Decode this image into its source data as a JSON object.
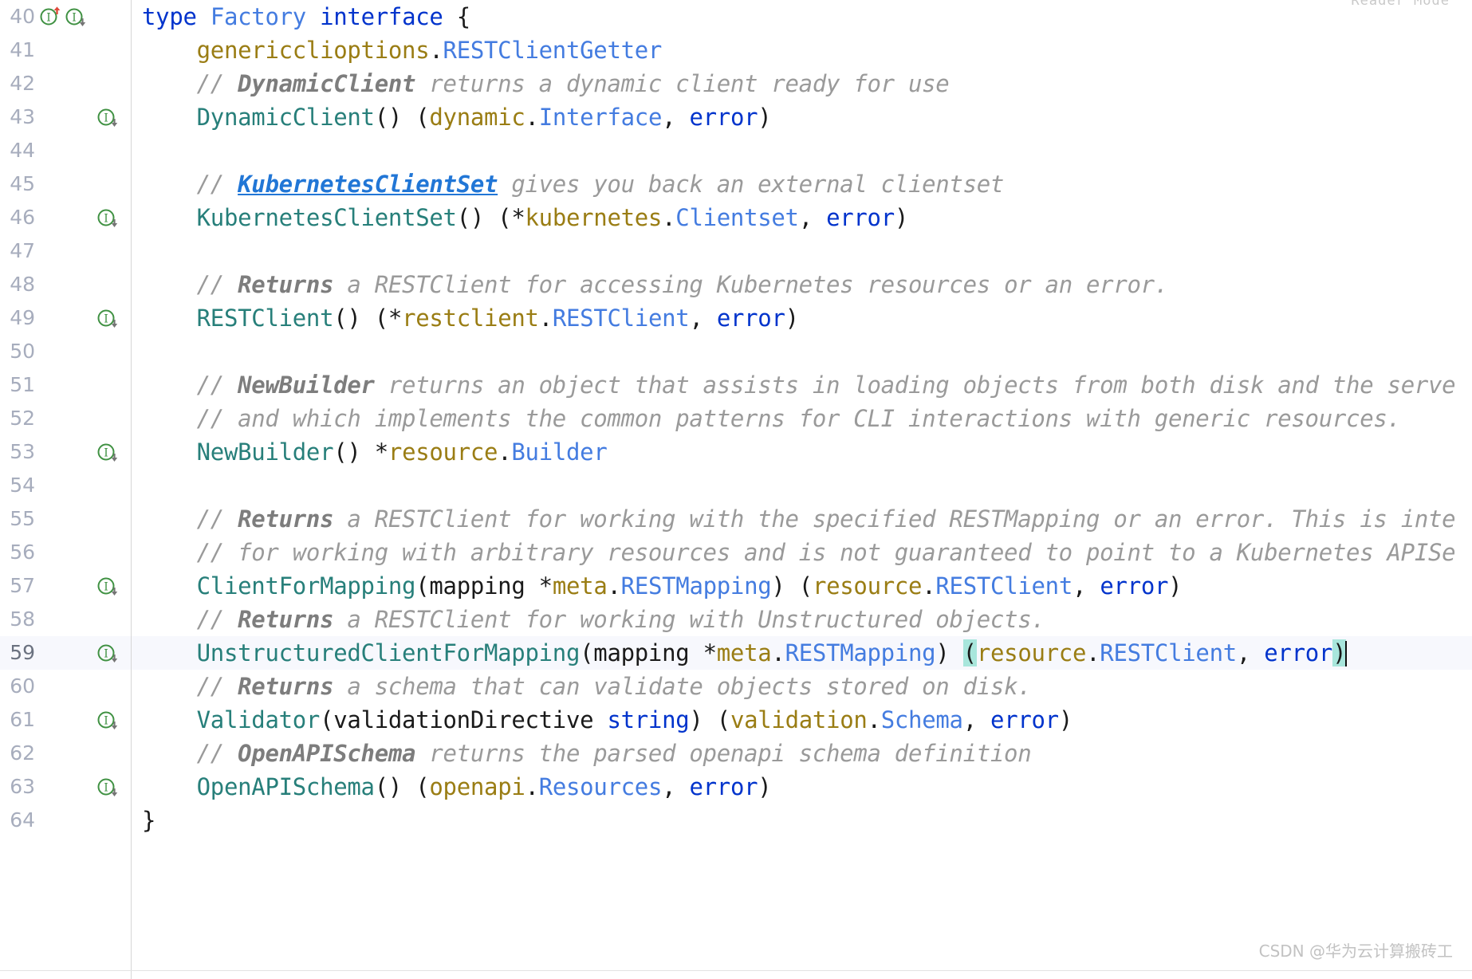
{
  "editor": {
    "reader_mode_label": "Reader Mode",
    "watermark": "CSDN @华为云计算搬砖工",
    "colors": {
      "background": "#ffffff",
      "current_line": "#f7f8fd",
      "keyword": "#0033cc",
      "package": "#9a7d14",
      "type": "#447ce0",
      "function": "#277f7a",
      "comment": "#9a9a9a",
      "comment_link": "#2176d6",
      "brace_match_highlight": "#a8e6dc",
      "gutter_line_number": "#a7adbd",
      "gutter_icon_green": "#3f9142",
      "gutter_arrow_red": "#e04a3c",
      "gutter_arrow_gray": "#757575"
    },
    "gutter_icons": {
      "implementing": "implementing-method-icon",
      "implemented": "implemented-method-icon"
    },
    "lines": [
      {
        "n": "40",
        "icons": [
          "implementing",
          "implemented"
        ],
        "current": false,
        "text": "type Factory interface {"
      },
      {
        "n": "41",
        "icons": [],
        "current": false,
        "text": "    genericclioptions.RESTClientGetter"
      },
      {
        "n": "42",
        "icons": [],
        "current": false,
        "text": "    // DynamicClient returns a dynamic client ready for use"
      },
      {
        "n": "43",
        "icons": [
          "implemented"
        ],
        "current": false,
        "text": "    DynamicClient() (dynamic.Interface, error)"
      },
      {
        "n": "44",
        "icons": [],
        "current": false,
        "text": ""
      },
      {
        "n": "45",
        "icons": [],
        "current": false,
        "text": "    // KubernetesClientSet gives you back an external clientset"
      },
      {
        "n": "46",
        "icons": [
          "implemented"
        ],
        "current": false,
        "text": "    KubernetesClientSet() (*kubernetes.Clientset, error)"
      },
      {
        "n": "47",
        "icons": [],
        "current": false,
        "text": ""
      },
      {
        "n": "48",
        "icons": [],
        "current": false,
        "text": "    // Returns a RESTClient for accessing Kubernetes resources or an error."
      },
      {
        "n": "49",
        "icons": [
          "implemented"
        ],
        "current": false,
        "text": "    RESTClient() (*restclient.RESTClient, error)"
      },
      {
        "n": "50",
        "icons": [],
        "current": false,
        "text": ""
      },
      {
        "n": "51",
        "icons": [],
        "current": false,
        "text": "    // NewBuilder returns an object that assists in loading objects from both disk and the serve"
      },
      {
        "n": "52",
        "icons": [],
        "current": false,
        "text": "    // and which implements the common patterns for CLI interactions with generic resources."
      },
      {
        "n": "53",
        "icons": [
          "implemented"
        ],
        "current": false,
        "text": "    NewBuilder() *resource.Builder"
      },
      {
        "n": "54",
        "icons": [],
        "current": false,
        "text": ""
      },
      {
        "n": "55",
        "icons": [],
        "current": false,
        "text": "    // Returns a RESTClient for working with the specified RESTMapping or an error. This is inte"
      },
      {
        "n": "56",
        "icons": [],
        "current": false,
        "text": "    // for working with arbitrary resources and is not guaranteed to point to a Kubernetes APISe"
      },
      {
        "n": "57",
        "icons": [
          "implemented"
        ],
        "current": false,
        "text": "    ClientForMapping(mapping *meta.RESTMapping) (resource.RESTClient, error)"
      },
      {
        "n": "58",
        "icons": [],
        "current": false,
        "text": "    // Returns a RESTClient for working with Unstructured objects."
      },
      {
        "n": "59",
        "icons": [
          "implemented"
        ],
        "current": true,
        "text": "    UnstructuredClientForMapping(mapping *meta.RESTMapping) (resource.RESTClient, error)"
      },
      {
        "n": "60",
        "icons": [],
        "current": false,
        "text": "    // Returns a schema that can validate objects stored on disk."
      },
      {
        "n": "61",
        "icons": [
          "implemented"
        ],
        "current": false,
        "text": "    Validator(validationDirective string) (validation.Schema, error)"
      },
      {
        "n": "62",
        "icons": [],
        "current": false,
        "text": "    // OpenAPISchema returns the parsed openapi schema definition"
      },
      {
        "n": "63",
        "icons": [
          "implemented"
        ],
        "current": false,
        "text": "    OpenAPISchema() (openapi.Resources, error)"
      },
      {
        "n": "64",
        "icons": [],
        "current": false,
        "text": "}"
      }
    ]
  }
}
